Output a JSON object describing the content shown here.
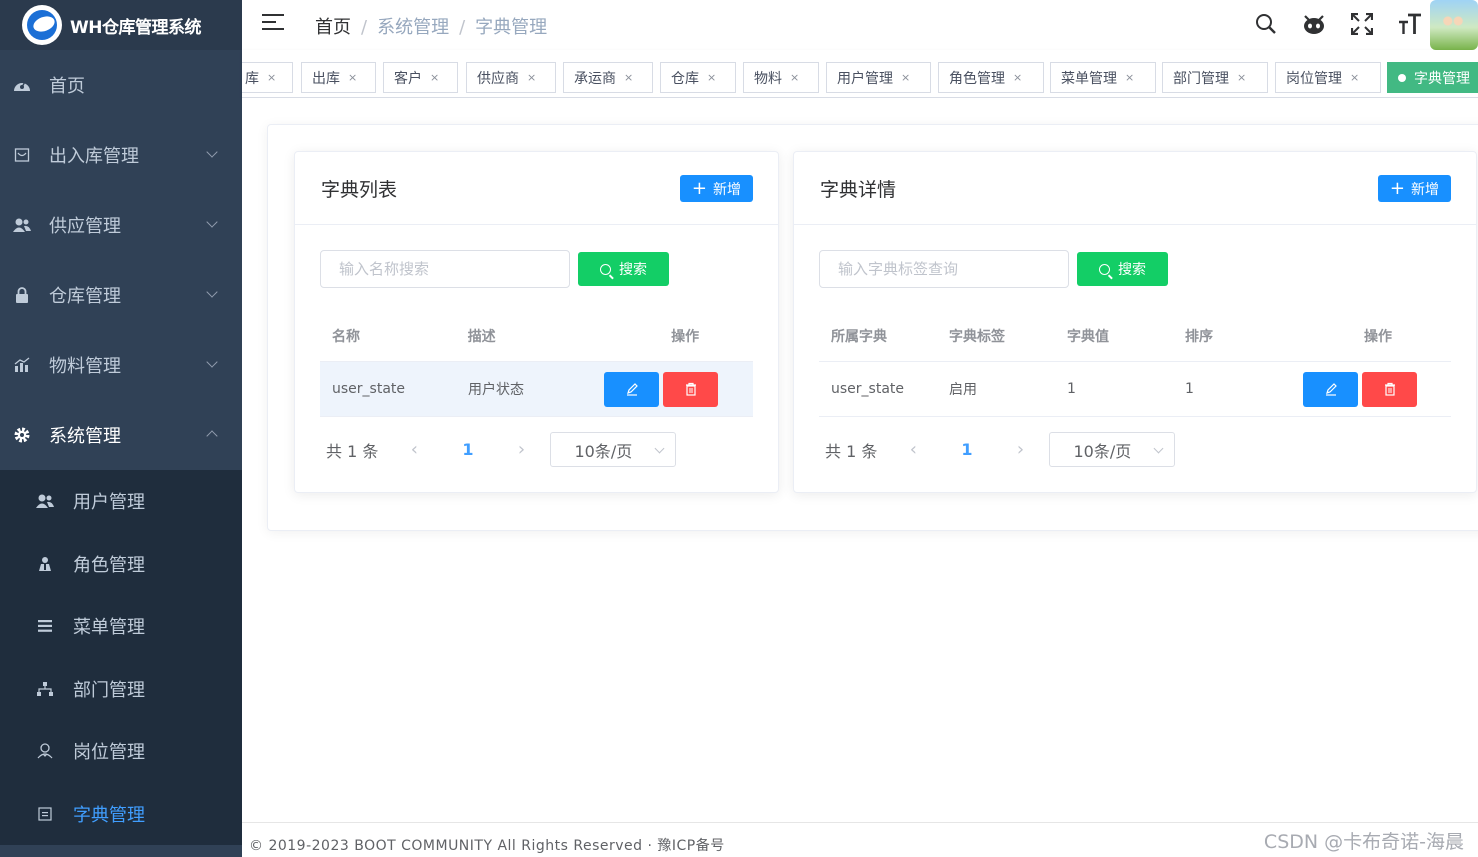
{
  "app": {
    "title": "WH仓库管理系统"
  },
  "sidebar": {
    "items": [
      {
        "label": "首页",
        "icon": "dashboard-icon"
      },
      {
        "label": "出入库管理",
        "icon": "inbox-icon"
      },
      {
        "label": "供应管理",
        "icon": "users-icon"
      },
      {
        "label": "仓库管理",
        "icon": "lock-icon"
      },
      {
        "label": "物料管理",
        "icon": "chart-icon"
      },
      {
        "label": "系统管理",
        "icon": "gear-icon"
      }
    ],
    "sub_items": [
      {
        "label": "用户管理",
        "icon": "user-icon"
      },
      {
        "label": "角色管理",
        "icon": "role-icon"
      },
      {
        "label": "菜单管理",
        "icon": "list-icon"
      },
      {
        "label": "部门管理",
        "icon": "tree-icon"
      },
      {
        "label": "岗位管理",
        "icon": "post-icon"
      },
      {
        "label": "字典管理",
        "icon": "dict-icon"
      }
    ]
  },
  "header": {
    "breadcrumb": [
      "首页",
      "系统管理",
      "字典管理"
    ],
    "separator": "/"
  },
  "tags": [
    {
      "label": "库"
    },
    {
      "label": "出库"
    },
    {
      "label": "客户"
    },
    {
      "label": "供应商"
    },
    {
      "label": "承运商"
    },
    {
      "label": "仓库"
    },
    {
      "label": "物料"
    },
    {
      "label": "用户管理"
    },
    {
      "label": "角色管理"
    },
    {
      "label": "菜单管理"
    },
    {
      "label": "部门管理"
    },
    {
      "label": "岗位管理"
    },
    {
      "label": "字典管理"
    }
  ],
  "tag_close": "×",
  "dict_list": {
    "title": "字典列表",
    "add_label": "新增",
    "search_placeholder": "输入名称搜索",
    "search_label": "搜索",
    "columns": [
      "名称",
      "描述",
      "操作"
    ],
    "rows": [
      {
        "name": "user_state",
        "desc": "用户状态"
      }
    ],
    "total": "共 1 条",
    "page": "1",
    "page_size": "10条/页"
  },
  "dict_detail": {
    "title": "字典详情",
    "add_label": "新增",
    "search_placeholder": "输入字典标签查询",
    "search_label": "搜索",
    "columns": [
      "所属字典",
      "字典标签",
      "字典值",
      "排序",
      "操作"
    ],
    "rows": [
      {
        "dict": "user_state",
        "label": "启用",
        "value": "1",
        "sort": "1"
      }
    ],
    "total": "共 1 条",
    "page": "1",
    "page_size": "10条/页"
  },
  "footer": {
    "text": "© 2019-2023 BOOT COMMUNITY All Rights Reserved · 豫ICP备号",
    "watermark": "CSDN @卡布奇诺-海晨"
  },
  "colors": {
    "sidebar": "#304156",
    "primary": "#1890ff",
    "success": "#13ce66",
    "danger": "#ff4949",
    "tag_active": "#42b983"
  }
}
